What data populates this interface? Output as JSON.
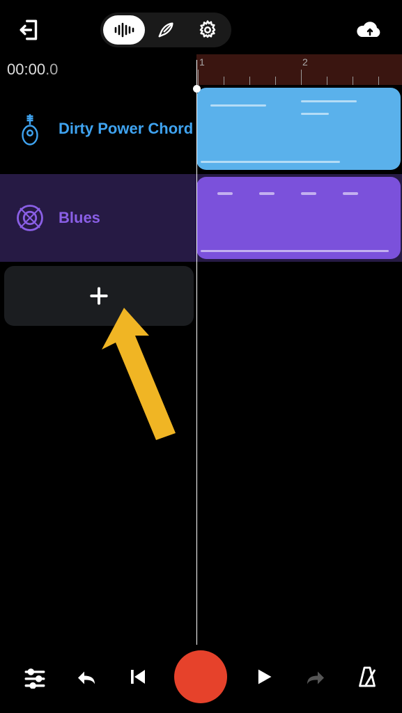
{
  "timeline": {
    "time_display_main": "00:00",
    "time_display_frac": ".0",
    "ruler_marks": [
      "1",
      "2"
    ]
  },
  "tracks": [
    {
      "label": "Dirty Power Chord",
      "icon": "guitar-icon",
      "color_label": "#3fa3f0",
      "clip_color": "#5ab1eb"
    },
    {
      "label": "Blues",
      "icon": "drum-icon",
      "color_label": "#8a5fe6",
      "clip_color": "#7b51db"
    }
  ],
  "top_tabs": {
    "items": [
      "audio-icon",
      "feather-icon",
      "gear-icon"
    ],
    "active": 0
  },
  "controls": {
    "add_track_icon": "plus-icon",
    "bottom": [
      "sliders-icon",
      "undo-icon",
      "skip-previous-icon",
      "record-icon",
      "play-icon",
      "redo-icon",
      "metronome-icon"
    ]
  },
  "tutorial": {
    "arrow_icon": "arrow-pointer-icon",
    "arrow_color": "#f0b524"
  }
}
